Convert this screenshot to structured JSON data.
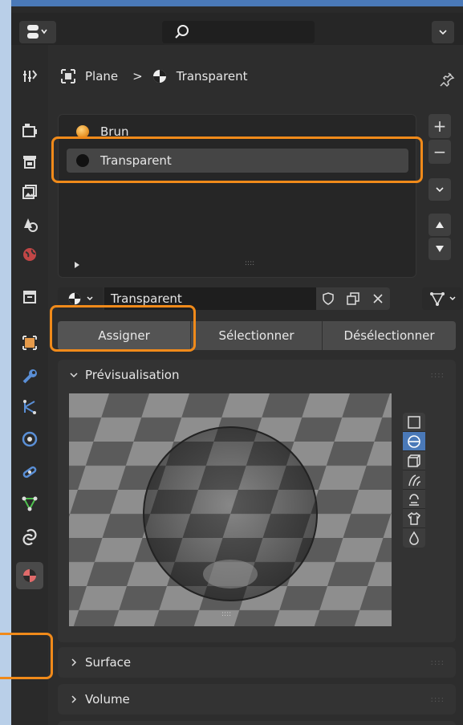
{
  "breadcrumb": {
    "object": "Plane",
    "separator": ">",
    "material": "Transparent"
  },
  "material_slots": [
    {
      "name": "Brun",
      "color": "#e8962a",
      "active": false
    },
    {
      "name": "Transparent",
      "color": "#111111",
      "active": true
    }
  ],
  "material_field": {
    "name": "Transparent"
  },
  "buttons": {
    "assign": "Assigner",
    "select": "Sélectionner",
    "deselect": "Désélectionner"
  },
  "side_buttons": {
    "add": "+",
    "remove": "−"
  },
  "sections": {
    "preview": "Prévisualisation",
    "surface": "Surface",
    "volume": "Volume"
  },
  "icons": {
    "sidebar": [
      "tool-icon",
      "render-icon",
      "output-icon",
      "view-layer-icon",
      "scene-icon",
      "world-icon",
      "collection-icon",
      "object-icon",
      "modifier-icon",
      "particles-icon",
      "physics-icon",
      "constraints-icon",
      "data-icon",
      "texture-icon",
      "material-icon"
    ]
  },
  "colors": {
    "accent": "#f08a1a",
    "active_blue": "#4a79b8"
  }
}
